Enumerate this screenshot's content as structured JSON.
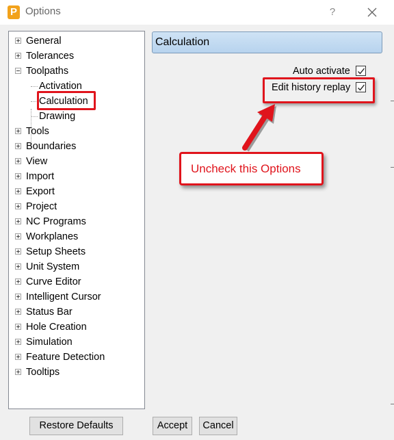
{
  "window": {
    "title": "Options",
    "app_icon_letter": "P",
    "help_label": "?"
  },
  "tree": {
    "items": [
      {
        "label": "General",
        "expander": "plus"
      },
      {
        "label": "Tolerances",
        "expander": "plus"
      },
      {
        "label": "Toolpaths",
        "expander": "minus"
      },
      {
        "label": "Activation",
        "child": true
      },
      {
        "label": "Calculation",
        "child": true,
        "selected": true
      },
      {
        "label": "Drawing",
        "child": true
      },
      {
        "label": "Tools",
        "expander": "plus"
      },
      {
        "label": "Boundaries",
        "expander": "plus"
      },
      {
        "label": "View",
        "expander": "plus"
      },
      {
        "label": "Import",
        "expander": "plus"
      },
      {
        "label": "Export",
        "expander": "plus"
      },
      {
        "label": "Project",
        "expander": "plus"
      },
      {
        "label": "NC Programs",
        "expander": "plus"
      },
      {
        "label": "Workplanes",
        "expander": "plus"
      },
      {
        "label": "Setup Sheets",
        "expander": "plus"
      },
      {
        "label": "Unit System",
        "expander": "plus"
      },
      {
        "label": "Curve Editor",
        "expander": "plus"
      },
      {
        "label": "Intelligent Cursor",
        "expander": "plus"
      },
      {
        "label": "Status Bar",
        "expander": "plus"
      },
      {
        "label": "Hole Creation",
        "expander": "plus"
      },
      {
        "label": "Simulation",
        "expander": "plus"
      },
      {
        "label": "Feature Detection",
        "expander": "plus"
      },
      {
        "label": "Tooltips",
        "expander": "plus"
      }
    ]
  },
  "panel": {
    "header": "Calculation",
    "options": [
      {
        "label": "Auto activate",
        "checked": true
      },
      {
        "label": "Edit history replay",
        "checked": true
      }
    ]
  },
  "annotation": {
    "callout_text": "Uncheck this Options",
    "color": "#e0141c"
  },
  "buttons": {
    "restore_defaults": "Restore Defaults",
    "accept": "Accept",
    "cancel": "Cancel"
  }
}
